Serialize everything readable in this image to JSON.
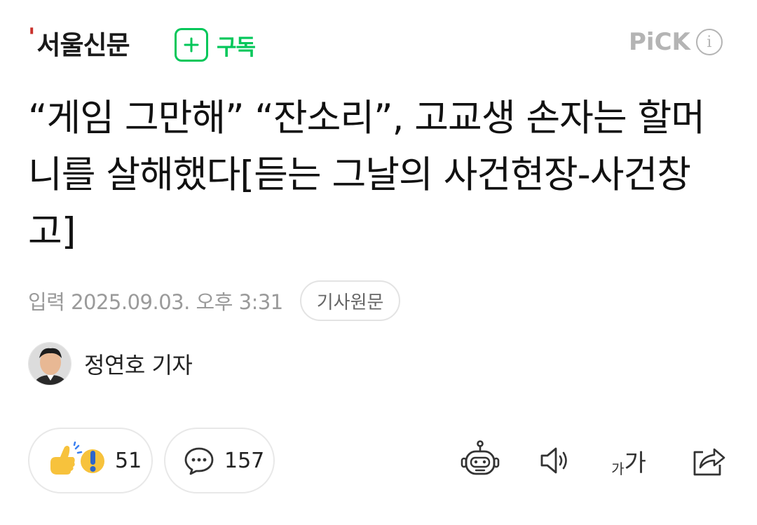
{
  "header": {
    "press_mark": "'",
    "press_name": "서울신문",
    "subscribe_label": "구독",
    "pick_label": "PiCK",
    "info_label": "i"
  },
  "article": {
    "headline": "“게임 그만해” “잔소리”, 고교생 손자는 할머니를 살해했다[듣는 그날의 사건현장-사건창고]",
    "date": "입력 2025.09.03. 오후 3:31",
    "original_button": "기사원문",
    "reporter": "정연호 기자"
  },
  "actions": {
    "reaction_count": "51",
    "comment_count": "157",
    "font_small": "가",
    "font_big": "가"
  },
  "colors": {
    "brand_green": "#03c75a",
    "press_red": "#c9312b",
    "muted_gray": "#9a9a9a"
  },
  "icons": [
    "plus-icon",
    "info-icon",
    "reaction-icon",
    "comment-icon",
    "summary-bot-icon",
    "speaker-icon",
    "font-size-icon",
    "share-icon"
  ]
}
